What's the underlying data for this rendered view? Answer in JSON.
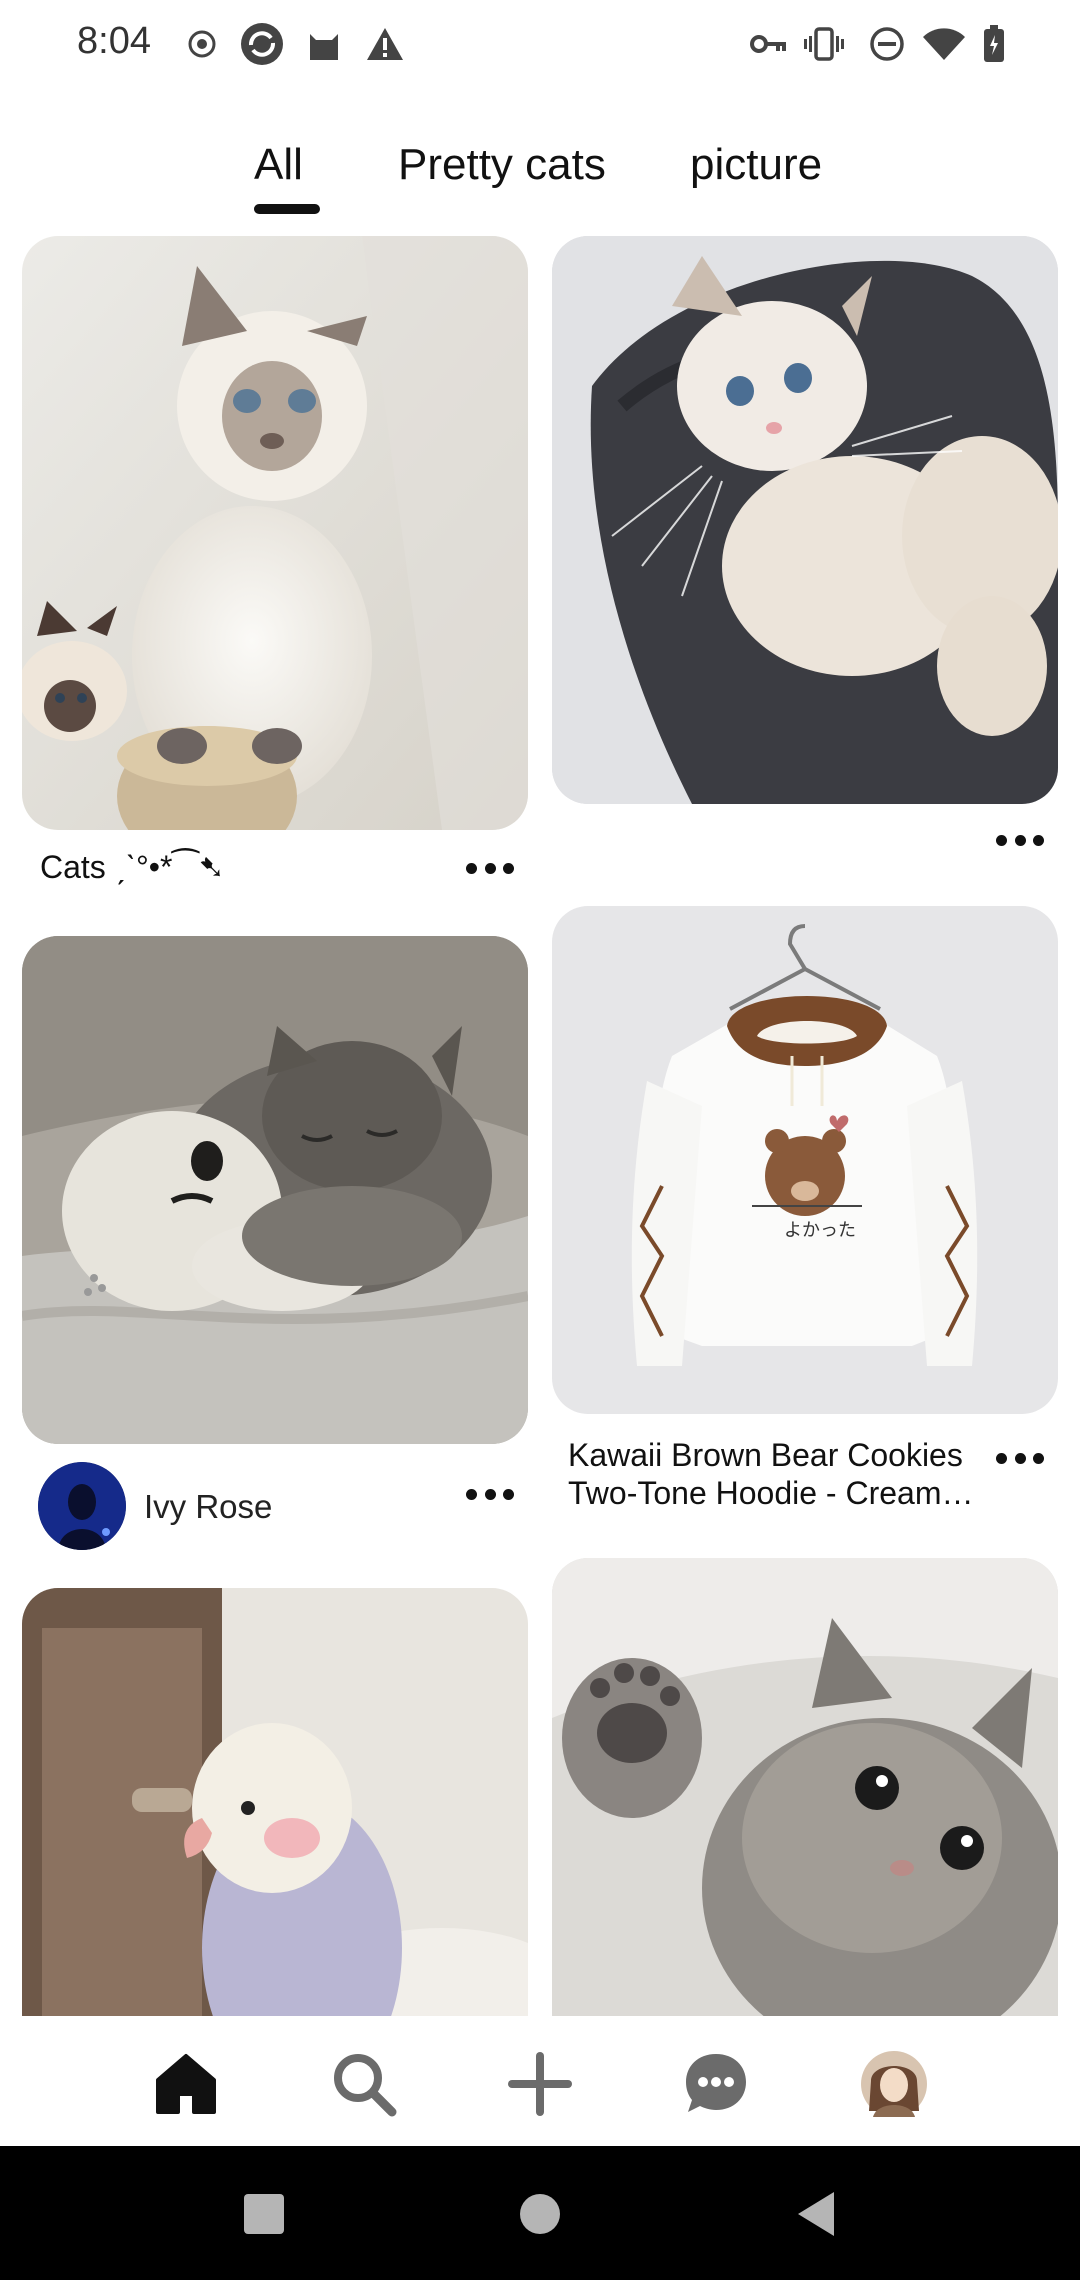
{
  "status_bar": {
    "time": "8:04",
    "left_icons": [
      "record-icon",
      "sync-icon",
      "cat-icon",
      "warning-icon"
    ],
    "right_icons": [
      "vpn-key-icon",
      "vibrate-icon",
      "do-not-disturb-icon",
      "wifi-icon",
      "battery-icon"
    ]
  },
  "tabs": [
    {
      "label": "All",
      "selected": true
    },
    {
      "label": "Pretty cats",
      "selected": false
    },
    {
      "label": "picture",
      "selected": false
    }
  ],
  "pins": [
    {
      "title": "Cats ˏˋ°•*⁀➷",
      "subject": "ragdoll-kitten"
    },
    {
      "title": "",
      "subject": "fluffy-kitten-held"
    },
    {
      "creator_name": "Ivy Rose",
      "subject": "sleeping-tabby-kitten"
    },
    {
      "title": "Kawaii Brown Bear Cookies Two-Tone Hoodie - Cream…",
      "subject": "bear-hoodie"
    },
    {
      "title": "",
      "subject": "lovebird"
    },
    {
      "title": "",
      "subject": "grey-kitten-paw"
    }
  ],
  "bottom_nav": [
    "home-icon",
    "search-icon",
    "create-icon",
    "messages-icon",
    "profile-avatar"
  ],
  "colors": {
    "accent": "#111111",
    "background": "#ffffff",
    "system_nav": "#000000"
  }
}
